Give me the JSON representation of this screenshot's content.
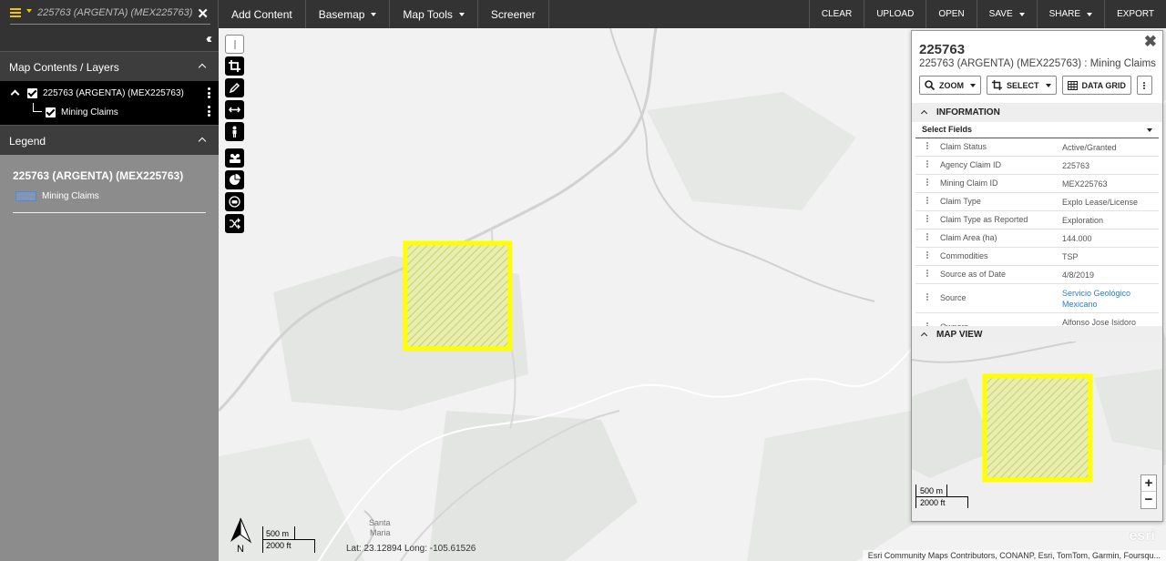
{
  "search": {
    "value": "225763 (ARGENTA)  (MEX225763)"
  },
  "toolbar": {
    "add_content": "Add Content",
    "basemap": "Basemap",
    "map_tools": "Map Tools",
    "screener": "Screener",
    "clear": "CLEAR",
    "upload": "UPLOAD",
    "open": "OPEN",
    "save": "SAVE",
    "share": "SHARE",
    "export": "EXPORT"
  },
  "sidebar": {
    "contents_title": "Map Contents / Layers",
    "layers": [
      {
        "label": "225763 (ARGENTA) (MEX225763)"
      },
      {
        "label": "Mining Claims"
      }
    ],
    "legend_title": "Legend",
    "legend_layer_title": "225763 (ARGENTA) (MEX225763)",
    "legend_item": "Mining Claims"
  },
  "map": {
    "place_label_1": "Santa",
    "place_label_2": "Maria",
    "north": "N",
    "scale_m": "500 m",
    "scale_ft": "2000 ft",
    "coords": "Lat: 23.12894  Long: -105.61526",
    "attribution": "Esri Community Maps Contributors, CONANP, Esri, TomTom, Garmin, Foursqu...",
    "esri": "esri",
    "highlight_color": "#ffff00"
  },
  "popup": {
    "title": "225763",
    "subtitle": "225763 (ARGENTA) (MEX225763) : Mining Claims",
    "zoom": "ZOOM",
    "select": "SELECT",
    "data_grid": "DATA GRID",
    "information": "INFORMATION",
    "select_fields": "Select Fields",
    "attributes": [
      {
        "name": "Claim Status",
        "value": "Active/Granted"
      },
      {
        "name": "Agency Claim ID",
        "value": "225763"
      },
      {
        "name": "Mining Claim ID",
        "value": "MEX225763"
      },
      {
        "name": "Claim Type",
        "value": "Explo Lease/License"
      },
      {
        "name": "Claim Type as Reported",
        "value": "Exploration"
      },
      {
        "name": "Claim Area (ha)",
        "value": "144.000"
      },
      {
        "name": "Commodities",
        "value": "TSP"
      },
      {
        "name": "Source as of Date",
        "value": "4/8/2019"
      },
      {
        "name": "Source",
        "value": "Servicio Geológico Mexicano"
      },
      {
        "name": "Owners",
        "value": "Alfonso Jose Isidoro Gonzalez Costa"
      }
    ],
    "map_view": "MAP VIEW",
    "zoom_in": "+",
    "zoom_out": "−",
    "scale_m": "500 m",
    "scale_ft": "2000 ft",
    "link_color": "#2a7ed0"
  }
}
